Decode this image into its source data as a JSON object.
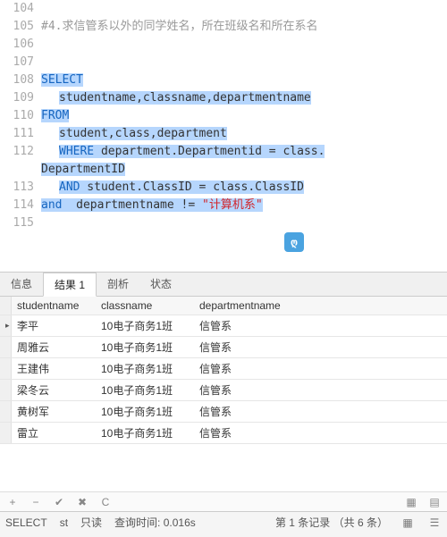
{
  "editor": {
    "lines": [
      {
        "n": "104",
        "segs": []
      },
      {
        "n": "105",
        "segs": [
          {
            "cls": "cmt",
            "t": "#4.求信管系以外的同学姓名，所在班级名和所在系名"
          }
        ]
      },
      {
        "n": "106",
        "segs": []
      },
      {
        "n": "107",
        "segs": []
      },
      {
        "n": "108",
        "segs": [
          {
            "cls": "kw sel",
            "t": "SELECT"
          }
        ]
      },
      {
        "n": "109",
        "segs": [
          {
            "cls": "ind",
            "t": ""
          },
          {
            "cls": "txt sel",
            "t": "studentname,classname,departmentname"
          }
        ]
      },
      {
        "n": "110",
        "segs": [
          {
            "cls": "kw sel",
            "t": "FROM"
          }
        ]
      },
      {
        "n": "111",
        "segs": [
          {
            "cls": "ind",
            "t": ""
          },
          {
            "cls": "txt sel",
            "t": "student,class,department"
          }
        ]
      },
      {
        "n": "112",
        "segs": [
          {
            "cls": "ind",
            "t": ""
          },
          {
            "cls": "kw sel",
            "t": "WHERE"
          },
          {
            "cls": "txt sel",
            "t": " department.Departmentid = class."
          },
          {
            "cls": "br",
            "t": ""
          },
          {
            "cls": "txt sel",
            "t": "DepartmentID"
          }
        ]
      },
      {
        "n": "113",
        "segs": [
          {
            "cls": "ind",
            "t": ""
          },
          {
            "cls": "kw sel",
            "t": "AND"
          },
          {
            "cls": "txt sel",
            "t": " student.ClassID = class.ClassID"
          }
        ]
      },
      {
        "n": "114",
        "segs": [
          {
            "cls": "kw sel",
            "t": "and"
          },
          {
            "cls": "txt sel",
            "t": "  departmentname != "
          },
          {
            "cls": "str sel",
            "t": "\"计算机系\""
          }
        ]
      },
      {
        "n": "115",
        "segs": []
      }
    ],
    "cursor_overlay": "ღ"
  },
  "tabs": {
    "items": [
      {
        "label": "信息",
        "active": false
      },
      {
        "label": "结果 1",
        "active": true
      },
      {
        "label": "剖析",
        "active": false
      },
      {
        "label": "状态",
        "active": false
      }
    ]
  },
  "grid": {
    "columns": [
      "studentname",
      "classname",
      "departmentname"
    ],
    "rows": [
      {
        "sel": true,
        "cells": [
          "李平",
          "10电子商务1班",
          "信管系"
        ]
      },
      {
        "sel": false,
        "cells": [
          "周雅云",
          "10电子商务1班",
          "信管系"
        ]
      },
      {
        "sel": false,
        "cells": [
          "王建伟",
          "10电子商务1班",
          "信管系"
        ]
      },
      {
        "sel": false,
        "cells": [
          "梁冬云",
          "10电子商务1班",
          "信管系"
        ]
      },
      {
        "sel": false,
        "cells": [
          "黄树军",
          "10电子商务1班",
          "信管系"
        ]
      },
      {
        "sel": false,
        "cells": [
          "雷立",
          "10电子商务1班",
          "信管系"
        ]
      }
    ]
  },
  "toolbar": {
    "add": "+",
    "remove": "−",
    "check": "✔",
    "cancel": "✖",
    "refresh": "C"
  },
  "status": {
    "stmt": "SELECT",
    "st": "st",
    "mode": "只读",
    "query_time": "查询时间: 0.016s",
    "record": "第 1 条记录 （共 6 条）"
  }
}
